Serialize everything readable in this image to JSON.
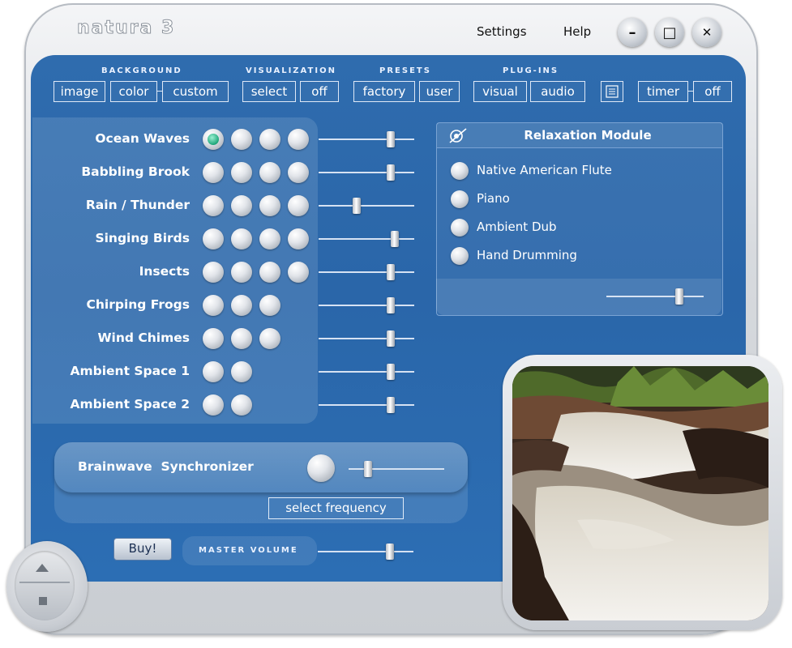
{
  "app": {
    "title": "natura 3"
  },
  "menu": {
    "settings": "Settings",
    "help": "Help"
  },
  "window_controls": {
    "minimize": "–",
    "maximize": "□",
    "close": "✕"
  },
  "toolbar": {
    "background": {
      "label": "BACKGROUND",
      "buttons": [
        "image",
        "color",
        "custom"
      ]
    },
    "visualization": {
      "label": "VISUALIZATION",
      "buttons": [
        "select",
        "off"
      ]
    },
    "presets": {
      "label": "PRESETS",
      "buttons": [
        "factory",
        "user"
      ]
    },
    "plugins": {
      "label": "PLUG-INS",
      "buttons": [
        "visual",
        "audio"
      ]
    },
    "timer": {
      "buttons": [
        "timer",
        "off"
      ]
    }
  },
  "sounds": [
    {
      "name": "Ocean Waves",
      "variants": 4,
      "active_variant": 1,
      "volume": 0.75
    },
    {
      "name": "Babbling Brook",
      "variants": 4,
      "active_variant": 0,
      "volume": 0.75
    },
    {
      "name": "Rain / Thunder",
      "variants": 4,
      "active_variant": 0,
      "volume": 0.4
    },
    {
      "name": "Singing Birds",
      "variants": 4,
      "active_variant": 0,
      "volume": 0.8
    },
    {
      "name": "Insects",
      "variants": 4,
      "active_variant": 0,
      "volume": 0.75
    },
    {
      "name": "Chirping Frogs",
      "variants": 3,
      "active_variant": 0,
      "volume": 0.75
    },
    {
      "name": "Wind Chimes",
      "variants": 3,
      "active_variant": 0,
      "volume": 0.75
    },
    {
      "name": "Ambient Space 1",
      "variants": 2,
      "active_variant": 0,
      "volume": 0.75
    },
    {
      "name": "Ambient Space 2",
      "variants": 2,
      "active_variant": 0,
      "volume": 0.75
    }
  ],
  "relaxation": {
    "title": "Relaxation  Module",
    "options": [
      "Native American Flute",
      "Piano",
      "Ambient Dub",
      "Hand Drumming"
    ],
    "volume": 0.75
  },
  "brainwave": {
    "label": "Brainwave  Synchronizer",
    "button": "select frequency",
    "level": 0.2
  },
  "buy": {
    "label": "Buy!"
  },
  "master": {
    "label": "MASTER VOLUME",
    "volume": 0.75
  },
  "colors": {
    "panel": "#2c6aae",
    "active": "#1ea77a"
  }
}
